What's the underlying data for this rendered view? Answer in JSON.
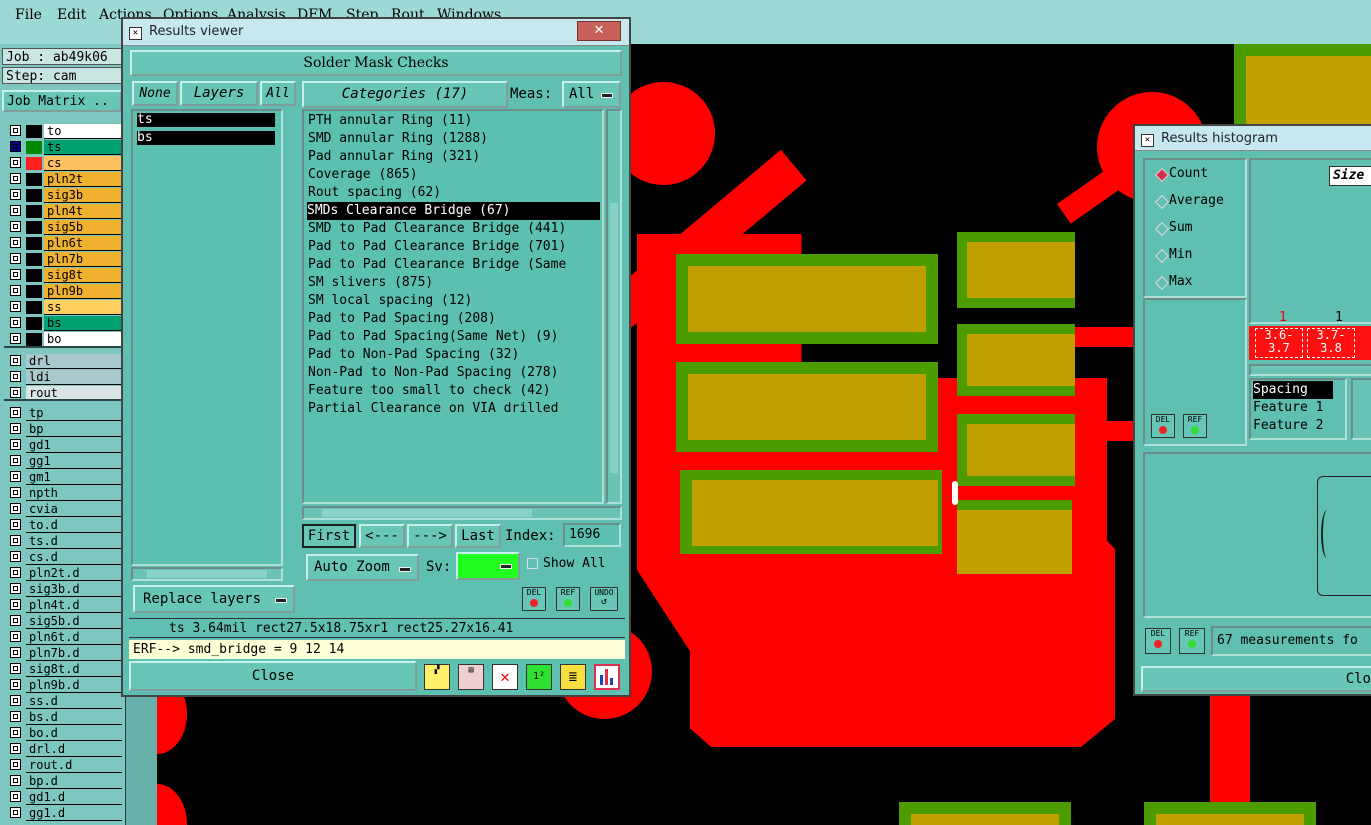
{
  "menu": [
    "File",
    "Edit",
    "Actions",
    "Options",
    "Analysis",
    "DFM",
    "Step",
    "Rout",
    "Windows"
  ],
  "left": {
    "job_label": "Job : ab49k06",
    "step_label": "Step: cam",
    "job_matrix_label": "Job Matrix ..",
    "layers_group1": [
      {
        "name": "to",
        "color": "#ffffff",
        "swatch": "#000000"
      },
      {
        "name": "ts",
        "color": "#00a070",
        "swatch": "#008800",
        "selected": true
      },
      {
        "name": "cs",
        "color": "#ffc060",
        "swatch": "#ff2020"
      },
      {
        "name": "pln2t",
        "color": "#f0b030",
        "swatch": "#000000"
      },
      {
        "name": "sig3b",
        "color": "#f0b030",
        "swatch": "#000000"
      },
      {
        "name": "pln4t",
        "color": "#f0b030",
        "swatch": "#000000"
      },
      {
        "name": "sig5b",
        "color": "#f0b030",
        "swatch": "#000000"
      },
      {
        "name": "pln6t",
        "color": "#f0b030",
        "swatch": "#000000"
      },
      {
        "name": "pln7b",
        "color": "#f0b030",
        "swatch": "#000000"
      },
      {
        "name": "sig8t",
        "color": "#f0b030",
        "swatch": "#000000"
      },
      {
        "name": "pln9b",
        "color": "#f0b030",
        "swatch": "#000000"
      },
      {
        "name": "ss",
        "color": "#ffd060",
        "swatch": "#000000"
      },
      {
        "name": "bs",
        "color": "#00a070",
        "swatch": "#000000"
      },
      {
        "name": "bo",
        "color": "#ffffff",
        "swatch": "#000000"
      }
    ],
    "layers_group2": [
      {
        "name": "drl",
        "color": "#a8c8cc"
      },
      {
        "name": "ldi",
        "color": "#a8c8cc"
      },
      {
        "name": "rout",
        "color": "#d8e4e6"
      }
    ],
    "layers_group3": [
      "tp",
      "bp",
      "gd1",
      "gg1",
      "gm1",
      "npth",
      "cvia",
      "to.d",
      "ts.d",
      "cs.d",
      "pln2t.d",
      "sig3b.d",
      "pln4t.d",
      "sig5b.d",
      "pln6t.d",
      "pln7b.d",
      "sig8t.d",
      "pln9b.d",
      "ss.d",
      "bs.d",
      "bo.d",
      "drl.d",
      "rout.d",
      "bp.d",
      "gd1.d",
      "gg1.d"
    ]
  },
  "results_viewer": {
    "title": "Results viewer",
    "header": "Solder Mask Checks",
    "none_btn": "None",
    "layers_btn": "Layers",
    "all_btn": "All",
    "layers": [
      "ts",
      "bs"
    ],
    "categories_btn": "Categories (17)",
    "meas_label": "Meas:",
    "meas_value": "All",
    "categories": [
      "PTH annular Ring (11)",
      "SMD annular Ring (1288)",
      "Pad annular Ring (321)",
      "Coverage (865)",
      "Rout spacing (62)",
      "SMDs Clearance Bridge (67)",
      "SMD to Pad Clearance Bridge (441)",
      "Pad to Pad Clearance Bridge (701)",
      "Pad to Pad Clearance Bridge (Same",
      "SM slivers (875)",
      "SM local spacing (12)",
      "Pad to Pad Spacing (208)",
      "Pad to Pad Spacing(Same Net) (9)",
      "Pad to Non-Pad Spacing (32)",
      "Non-Pad to Non-Pad Spacing (278)",
      "Feature too small to check (42)",
      "Partial Clearance on VIA drilled"
    ],
    "selected_index": 5,
    "first_btn": "First",
    "prev_btn": "<---",
    "next_btn": "--->",
    "last_btn": "Last",
    "index_label": "Index:",
    "index_value": "1696",
    "auto_zoom": "Auto Zoom",
    "sv_label": "Sv:",
    "show_all": "Show All",
    "replace_layers": "Replace layers",
    "del_label": "DEL",
    "ref_label": "REF",
    "undo_label": "UNDO",
    "status_line": "ts 3.64mil  rect27.5x18.75xr1  rect25.27x16.41",
    "erf_line": "ERF--> smd_bridge = 9 12 14",
    "close_btn": "Close"
  },
  "histogram": {
    "title": "Results histogram",
    "modes": [
      "Count",
      "Average",
      "Sum",
      "Min",
      "Max"
    ],
    "selected_mode": "Count",
    "size_label": "Size",
    "bin_counts": [
      "1",
      "1"
    ],
    "bins": [
      "3.6-\n3.7",
      "3.7-\n3.8"
    ],
    "fields": [
      "Spacing",
      "Feature 1",
      "Feature 2"
    ],
    "measure_text": "67 measurements fo",
    "del_label": "DEL",
    "ref_label": "REF",
    "close_btn": "Clo"
  }
}
